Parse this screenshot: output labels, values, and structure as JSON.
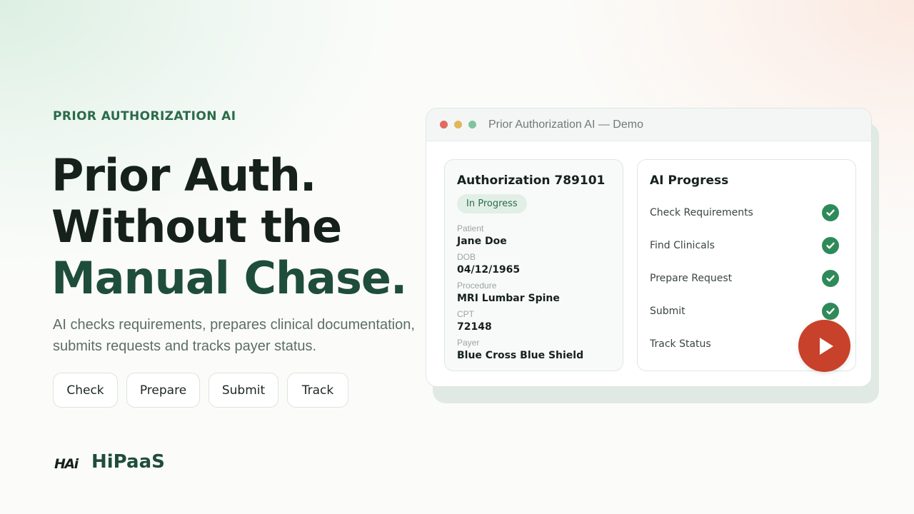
{
  "hero": {
    "eyebrow": "PRIOR AUTHORIZATION AI",
    "headline_line1": "Prior Auth.",
    "headline_line2": "Without the",
    "headline_line3": "Manual Chase.",
    "subtext": "AI checks requirements, prepares clinical documentation, submits requests and tracks payer status.",
    "pills": [
      "Check",
      "Prepare",
      "Submit",
      "Track"
    ]
  },
  "logo": {
    "mark": "HAi",
    "name": "HiPaaS"
  },
  "window": {
    "title": "Prior Authorization AI  —  Demo",
    "dots": [
      "#e06b5f",
      "#e2b65b",
      "#7fc49a"
    ]
  },
  "auth_card": {
    "title": "Authorization 789101",
    "status": "In Progress",
    "fields": [
      {
        "label": "Patient",
        "value": "Jane Doe"
      },
      {
        "label": "DOB",
        "value": "04/12/1965"
      },
      {
        "label": "Procedure",
        "value": "MRI Lumbar Spine"
      },
      {
        "label": "CPT",
        "value": "72148"
      },
      {
        "label": "Payer",
        "value": "Blue Cross Blue Shield"
      }
    ]
  },
  "progress_card": {
    "title": "AI Progress",
    "steps": [
      {
        "label": "Check Requirements",
        "done": true
      },
      {
        "label": "Find Clinicals",
        "done": true
      },
      {
        "label": "Prepare Request",
        "done": true
      },
      {
        "label": "Submit",
        "done": true
      },
      {
        "label": "Track Status",
        "done": false
      }
    ]
  },
  "icons": {
    "check": "check-circle-icon",
    "play": "play-icon"
  },
  "colors": {
    "brand_green": "#1f4d3b",
    "accent_green": "#2b6b4a",
    "check_green": "#2f8a5a",
    "play_red": "#c8412a"
  }
}
